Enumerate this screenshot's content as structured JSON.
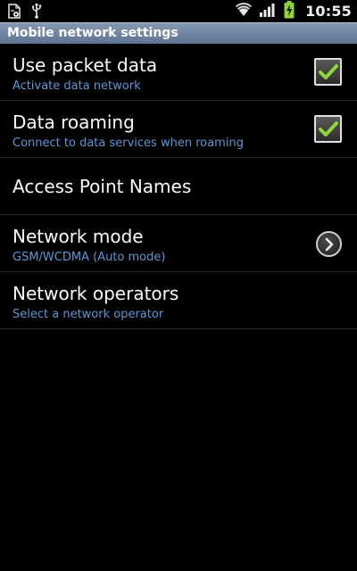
{
  "status_bar": {
    "time": "10:55",
    "left_icons": [
      "settings-document-icon",
      "usb-icon"
    ],
    "right_icons": [
      "wifi-icon",
      "signal-icon",
      "battery-charging-icon"
    ]
  },
  "header": {
    "title": "Mobile network settings"
  },
  "settings": [
    {
      "title": "Use packet data",
      "subtitle": "Activate data network",
      "control": "checkbox",
      "checked": true
    },
    {
      "title": "Data roaming",
      "subtitle": "Connect to data services when roaming",
      "control": "checkbox",
      "checked": true
    },
    {
      "title": "Access Point Names",
      "subtitle": "",
      "control": "none"
    },
    {
      "title": "Network mode",
      "subtitle": "GSM/WCDMA (Auto mode)",
      "control": "chevron"
    },
    {
      "title": "Network operators",
      "subtitle": "Select a network operator",
      "control": "none"
    }
  ],
  "colors": {
    "background": "#000000",
    "title_bar": "#6d81a0",
    "subtitle_text": "#5f97d4",
    "check_mark": "#8fd43a",
    "battery": "#8fd43a"
  }
}
